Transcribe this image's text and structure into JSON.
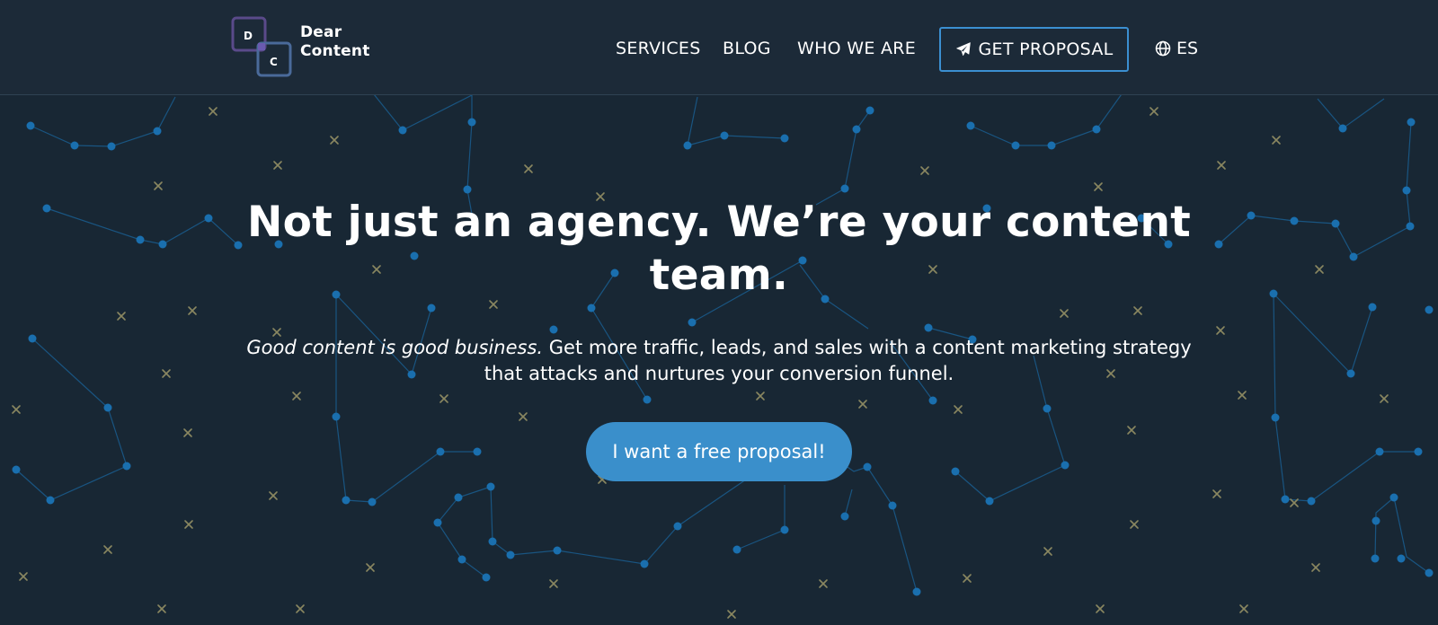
{
  "brand": {
    "logo_letters": [
      "D",
      "C"
    ],
    "name_line1": "Dear",
    "name_line2": "Content"
  },
  "nav": {
    "items": [
      {
        "label": "SERVICES"
      },
      {
        "label": "BLOG"
      },
      {
        "label": "WHO WE ARE"
      }
    ],
    "proposal_button": {
      "label": "GET PROPOSAL",
      "icon": "paper-plane-icon"
    },
    "language": {
      "label": "ES",
      "icon": "globe-icon"
    }
  },
  "hero": {
    "title": "Not just an agency. We’re your content team.",
    "subtitle_emphasis": "Good content is good business.",
    "subtitle_rest": " Get more traffic, leads, and sales with a content marketing strategy that attacks and nurtures your conversion funnel.",
    "cta_label": "I want a free proposal!"
  },
  "colors": {
    "background": "#182734",
    "header": "#1c2a38",
    "accent": "#3a8fcb",
    "constellation_dot": "#1f6fae",
    "cross": "#8a8760"
  }
}
